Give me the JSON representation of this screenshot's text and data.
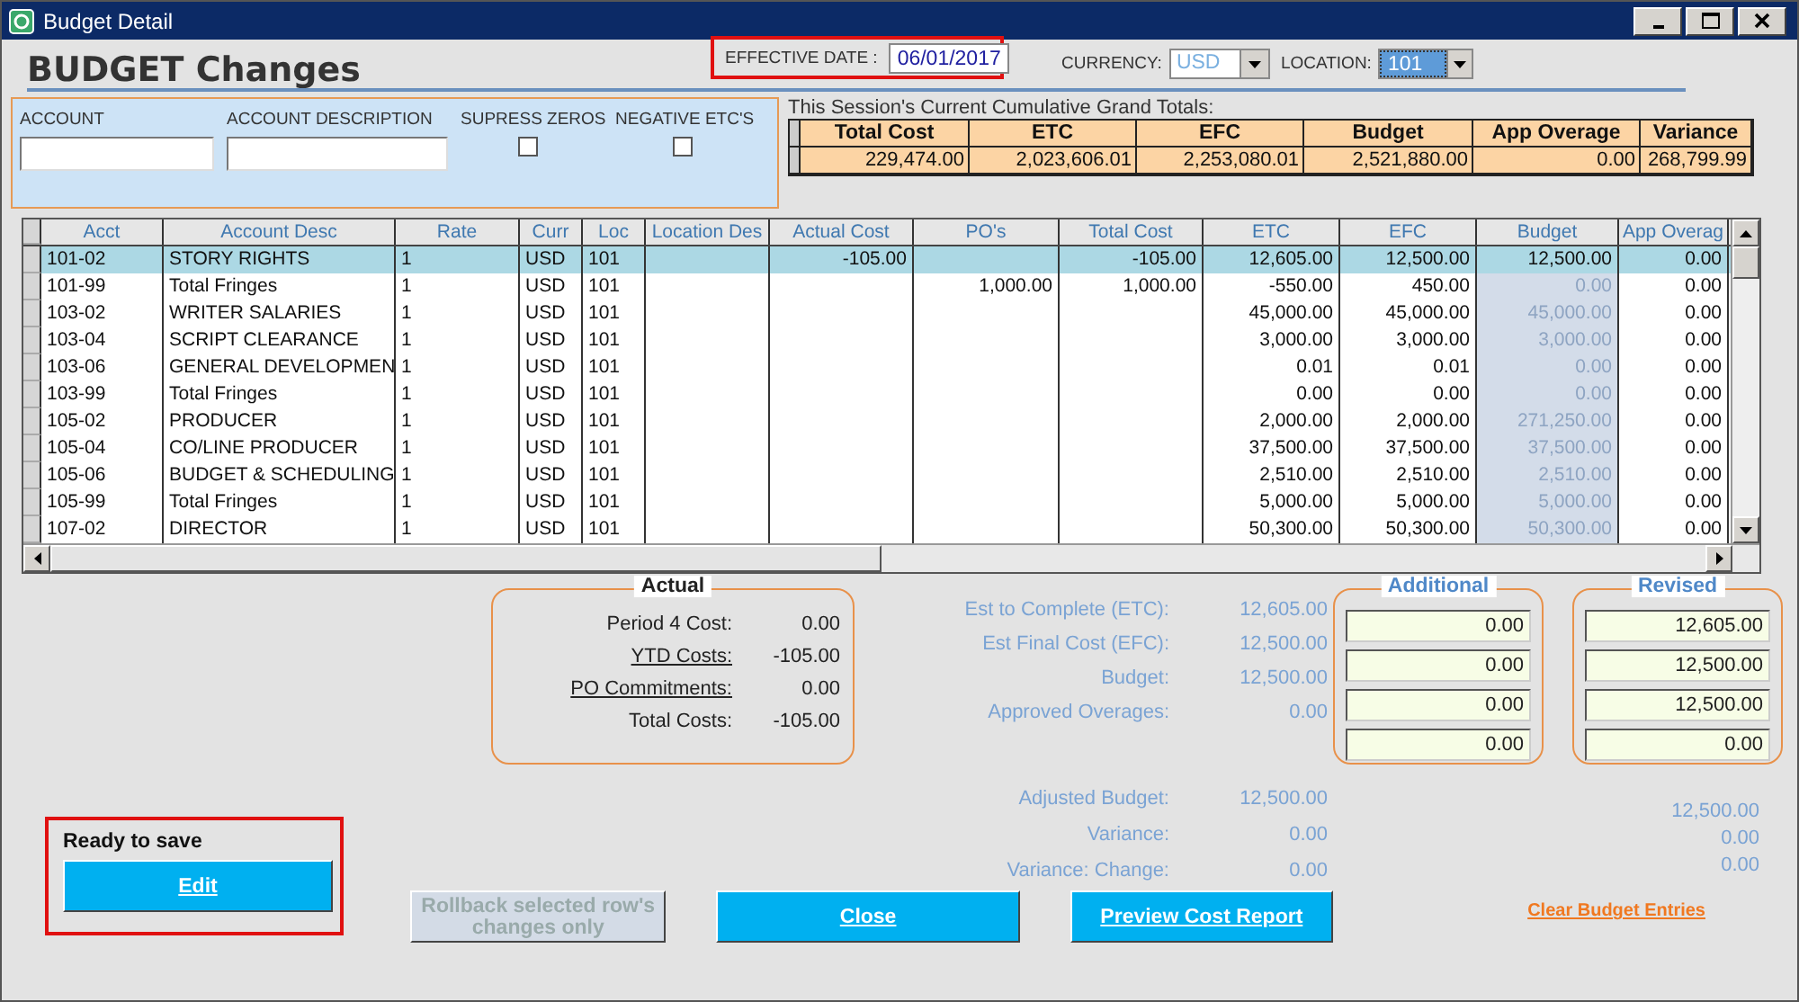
{
  "window": {
    "title": "Budget Detail"
  },
  "header": {
    "title": "BUDGET Changes",
    "effective_date": {
      "label": "EFFECTIVE DATE :",
      "value": "06/01/2017"
    },
    "currency": {
      "label": "CURRENCY:",
      "value": "USD"
    },
    "location": {
      "label": "LOCATION:",
      "value": "101"
    }
  },
  "filters": {
    "account": {
      "label": "ACCOUNT"
    },
    "account_description": {
      "label": "ACCOUNT DESCRIPTION"
    },
    "supress_zeros": {
      "label": "SUPRESS ZEROS",
      "checked": false
    },
    "negative_etcs": {
      "label": "NEGATIVE ETC'S",
      "checked": false
    }
  },
  "grand_totals": {
    "caption": "This Session's Current Cumulative Grand Totals:",
    "columns": [
      "Total Cost",
      "ETC",
      "EFC",
      "Budget",
      "App Overage",
      "Variance"
    ],
    "values": [
      "229,474.00",
      "2,023,606.01",
      "2,253,080.01",
      "2,521,880.00",
      "0.00",
      "268,799.99"
    ]
  },
  "grid": {
    "columns": [
      "Acct",
      "Account Desc",
      "Rate",
      "Curr",
      "Loc",
      "Location Des",
      "Actual Cost",
      "PO's",
      "Total Cost",
      "ETC",
      "EFC",
      "Budget",
      "App Overag"
    ],
    "rows": [
      {
        "selected": true,
        "cells": [
          "101-02",
          "STORY RIGHTS",
          "1",
          "USD",
          "101",
          "",
          "-105.00",
          "",
          "-105.00",
          "12,605.00",
          "12,500.00",
          "12,500.00",
          "0.00"
        ]
      },
      {
        "selected": false,
        "cells": [
          "101-99",
          "Total Fringes",
          "1",
          "USD",
          "101",
          "",
          "",
          "1,000.00",
          "1,000.00",
          "-550.00",
          "450.00",
          "0.00",
          "0.00"
        ]
      },
      {
        "selected": false,
        "cells": [
          "103-02",
          "WRITER SALARIES",
          "1",
          "USD",
          "101",
          "",
          "",
          "",
          "",
          "45,000.00",
          "45,000.00",
          "45,000.00",
          "0.00"
        ]
      },
      {
        "selected": false,
        "cells": [
          "103-04",
          "SCRIPT CLEARANCE",
          "1",
          "USD",
          "101",
          "",
          "",
          "",
          "",
          "3,000.00",
          "3,000.00",
          "3,000.00",
          "0.00"
        ]
      },
      {
        "selected": false,
        "cells": [
          "103-06",
          "GENERAL DEVELOPMEN",
          "1",
          "USD",
          "101",
          "",
          "",
          "",
          "",
          "0.01",
          "0.01",
          "0.00",
          "0.00"
        ]
      },
      {
        "selected": false,
        "cells": [
          "103-99",
          "Total Fringes",
          "1",
          "USD",
          "101",
          "",
          "",
          "",
          "",
          "0.00",
          "0.00",
          "0.00",
          "0.00"
        ]
      },
      {
        "selected": false,
        "cells": [
          "105-02",
          "PRODUCER",
          "1",
          "USD",
          "101",
          "",
          "",
          "",
          "",
          "2,000.00",
          "2,000.00",
          "271,250.00",
          "0.00"
        ]
      },
      {
        "selected": false,
        "cells": [
          "105-04",
          "CO/LINE PRODUCER",
          "1",
          "USD",
          "101",
          "",
          "",
          "",
          "",
          "37,500.00",
          "37,500.00",
          "37,500.00",
          "0.00"
        ]
      },
      {
        "selected": false,
        "cells": [
          "105-06",
          "BUDGET & SCHEDULING",
          "1",
          "USD",
          "101",
          "",
          "",
          "",
          "",
          "2,510.00",
          "2,510.00",
          "2,510.00",
          "0.00"
        ]
      },
      {
        "selected": false,
        "cells": [
          "105-99",
          "Total Fringes",
          "1",
          "USD",
          "101",
          "",
          "",
          "",
          "",
          "5,000.00",
          "5,000.00",
          "5,000.00",
          "0.00"
        ]
      },
      {
        "selected": false,
        "cells": [
          "107-02",
          "DIRECTOR",
          "1",
          "USD",
          "101",
          "",
          "",
          "",
          "",
          "50,300.00",
          "50,300.00",
          "50,300.00",
          "0.00"
        ]
      }
    ]
  },
  "actual": {
    "title": "Actual",
    "rows": [
      {
        "label": "Period 4 Cost:",
        "value": "0.00",
        "kind": "plain"
      },
      {
        "label": "YTD Costs:",
        "value": "-105.00",
        "kind": "link"
      },
      {
        "label": "PO Commitments:",
        "value": "0.00",
        "kind": "link"
      },
      {
        "label": "Total Costs:",
        "value": "-105.00",
        "kind": "plain"
      }
    ]
  },
  "estimates": [
    {
      "label": "Est to Complete (ETC):",
      "value": "12,605.00"
    },
    {
      "label": "Est Final Cost (EFC):",
      "value": "12,500.00"
    },
    {
      "label": "Budget:",
      "value": "12,500.00"
    },
    {
      "label": "Approved Overages:",
      "value": "0.00"
    }
  ],
  "additional": {
    "title": "Additional",
    "values": [
      "0.00",
      "0.00",
      "0.00",
      "0.00"
    ]
  },
  "revised": {
    "title": "Revised",
    "values": [
      "12,605.00",
      "12,500.00",
      "12,500.00",
      "0.00"
    ]
  },
  "adjusted": [
    {
      "label": "Adjusted Budget:",
      "value": "12,500.00"
    },
    {
      "label": "Variance:",
      "value": "0.00"
    },
    {
      "label": "Variance: Change:",
      "value": "0.00"
    }
  ],
  "revised_totals": [
    "12,500.00",
    "0.00",
    "0.00"
  ],
  "status": "Ready to save",
  "buttons": [
    {
      "label": "Edit",
      "disabled": false
    },
    {
      "label": "Rollback selected row's changes only",
      "disabled": true
    },
    {
      "label": "Close",
      "disabled": false
    },
    {
      "label": "Preview Cost Report",
      "disabled": false
    }
  ],
  "link": "Clear Budget Entries"
}
